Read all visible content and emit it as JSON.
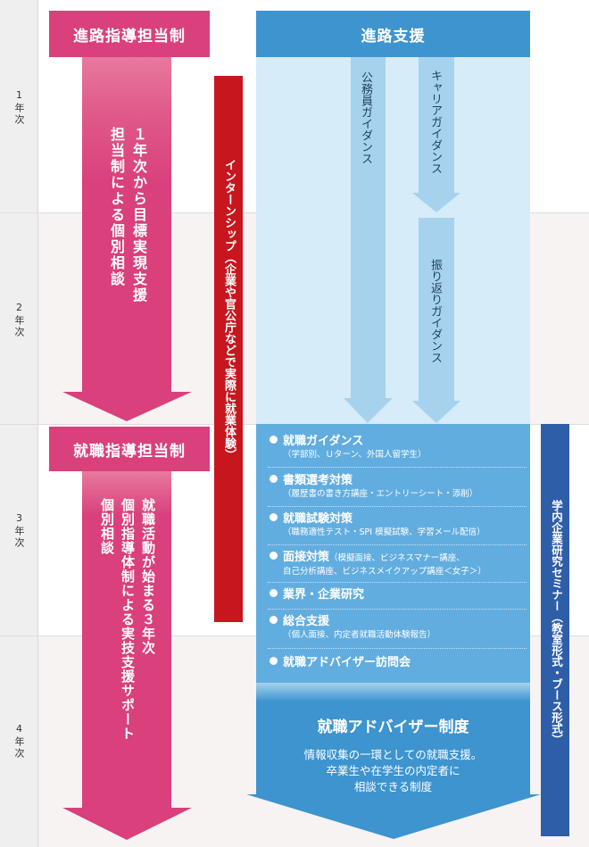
{
  "years": [
    "1年次",
    "2年次",
    "3年次",
    "4年次"
  ],
  "left": {
    "header_top": "進路指導担当制",
    "top_text_col1": "１年次から目標実現支援",
    "top_text_col2": "担当制による個別相談",
    "header_bottom": "就職指導担当制",
    "bottom_text_col1": "就職活動が始まる３年次",
    "bottom_text_col2": "個別指導体制による実技支援サポート",
    "bottom_text_col3": "個別相談"
  },
  "internship": "インターンシップ（企業や官公庁などで実際に就業体験）",
  "right": {
    "header": "進路支援",
    "arrow1": "公務員ガイダンス",
    "arrow2": "キャリアガイダンス",
    "arrow3": "振り返りガイダンス",
    "items": [
      {
        "title": "就職ガイダンス",
        "sub": "（学部別、Ｕターン、外国人留学生）"
      },
      {
        "title": "書類選考対策",
        "sub": "（履歴書の書き方講座・エントリーシート・添削）"
      },
      {
        "title": "就職試験対策",
        "sub": "（職務適性テスト・SPI 模擬試験、学習メール配信）"
      },
      {
        "title": "面接対策",
        "title_note": "（模擬面接、ビジネスマナー講座、",
        "sub": "自己分析講座、ビジネスメイクアップ講座＜女子＞）"
      },
      {
        "title": "業界・企業研究",
        "sub": ""
      },
      {
        "title": "総合支援",
        "sub": "（個人面接、内定者就職活動体験報告）"
      },
      {
        "title": "就職アドバイザー訪問会",
        "sub": ""
      }
    ],
    "advisor_title": "就職アドバイザー制度",
    "advisor_lines": [
      "情報収集の一環としての就職支援。",
      "卒業生や在学生の内定者に",
      "相談できる制度"
    ]
  },
  "seminar": "学内企業研究セミナー（教室形式・ブース形式）",
  "colors": {
    "pink": "#d9407c",
    "pink_light": "#e25a90",
    "red": "#c8161e",
    "blue": "#3d94cf",
    "blue_light": "#d6ecf8",
    "blue_arrow": "#a7d2ee",
    "blue_panel": "#62ade0",
    "navy": "#2f5ea8"
  }
}
